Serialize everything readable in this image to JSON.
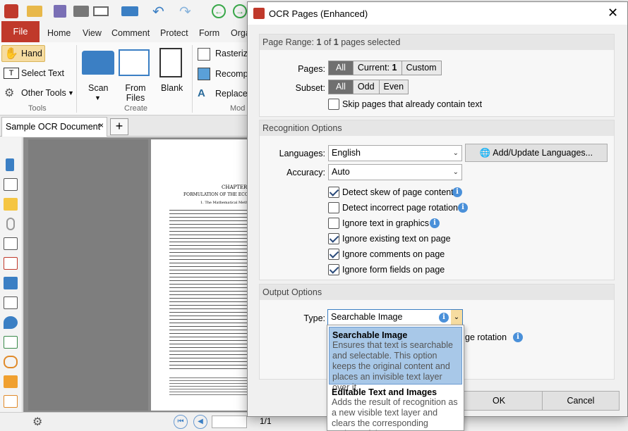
{
  "app": {
    "ribbon_tabs": [
      "File",
      "Home",
      "View",
      "Comment",
      "Protect",
      "Form",
      "Orga"
    ],
    "tools": {
      "hand": "Hand",
      "select_text": "Select Text",
      "other_tools": "Other Tools",
      "group": "Tools"
    },
    "create": {
      "scan": "Scan",
      "from_files": "From Files",
      "blank": "Blank",
      "group": "Create"
    },
    "modify": {
      "rasterize": "Rasterize",
      "recompress": "Recompr",
      "replace": "Replace",
      "group": "Mod"
    },
    "doc_tab": "Sample OCR Document",
    "page_text": {
      "chapter": "CHAPTER",
      "heading": "FORMULATION OF THE ECO",
      "sub": "1. The Mathematical Meth"
    },
    "status_page": "1/1"
  },
  "dialog": {
    "title": "OCR Pages (Enhanced)",
    "page_range": {
      "header_pre": "Page Range: ",
      "current": "1",
      "of": " of ",
      "total": "1",
      "header_post": " pages selected",
      "pages_label": "Pages:",
      "pages_all": "All",
      "pages_current": "Current: ",
      "pages_current_num": "1",
      "pages_custom": "Custom",
      "subset_label": "Subset:",
      "subset_all": "All",
      "subset_odd": "Odd",
      "subset_even": "Even",
      "skip": "Skip pages that already contain text"
    },
    "recognition": {
      "header": "Recognition Options",
      "languages_label": "Languages:",
      "languages_value": "English",
      "add_languages": "Add/Update Languages...",
      "accuracy_label": "Accuracy:",
      "accuracy_value": "Auto",
      "options": [
        {
          "label": "Detect skew of page content",
          "checked": true,
          "info": true
        },
        {
          "label": "Detect incorrect page rotation",
          "checked": false,
          "info": true
        },
        {
          "label": "Ignore text in graphics",
          "checked": false,
          "info": true
        },
        {
          "label": "Ignore existing text on page",
          "checked": true,
          "info": false
        },
        {
          "label": "Ignore comments on page",
          "checked": true,
          "info": false
        },
        {
          "label": "Ignore form fields on page",
          "checked": true,
          "info": false
        }
      ]
    },
    "output": {
      "header": "Output Options",
      "type_label": "Type:",
      "type_value": "Searchable Image",
      "behind_text": "ge rotation",
      "dropdown": [
        {
          "title": "Searchable Image",
          "desc": "Ensures that text is searchable and selectable. This option keeps the original content and places an invisible text layer over it.",
          "selected": true
        },
        {
          "title": "Editable Text and Images",
          "desc": "Adds the result of recognition as a new visible text layer and clears the corresponding regions of the",
          "selected": false
        }
      ]
    },
    "ok": "OK",
    "cancel": "Cancel"
  },
  "colors": {
    "file_tab": "#c0392b",
    "selection": "#a8c8e8",
    "info": "#4a90d9"
  }
}
